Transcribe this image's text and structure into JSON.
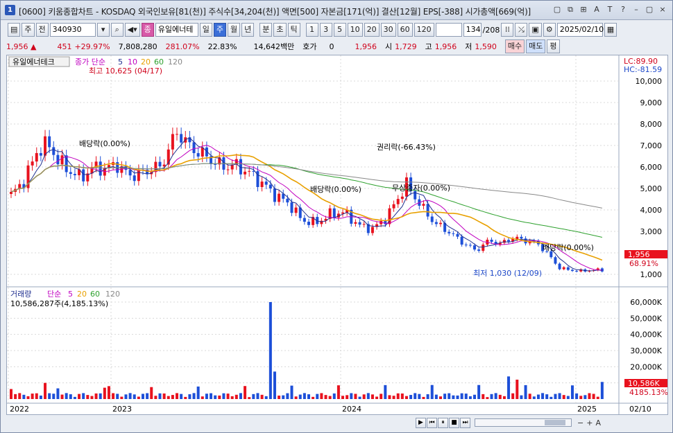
{
  "window": {
    "app_num": "1",
    "title": "[0600] 키움종합차트 - KOSDAQ 외국인보유[81(천)] 주식수[34,204(천)] 액면[500] 자본금[171(억)] 결산[12월] EPS[-388] 시가총액[669(억)]",
    "controls": [
      "▢",
      "⧉",
      "⊞",
      "A",
      "T",
      "?",
      "–",
      "▢",
      "×"
    ]
  },
  "toolbar": {
    "period_select": "주",
    "all_label": "전",
    "code": "340930",
    "stock_name": "유일에너테",
    "stock_name_prefix": "종",
    "period_buttons": [
      "일",
      "주",
      "월",
      "년"
    ],
    "active_period": "주",
    "time_buttons": [
      "분",
      "초",
      "틱"
    ],
    "interval_buttons": [
      "1",
      "3",
      "5",
      "10",
      "20",
      "30",
      "60",
      "120"
    ],
    "count": "134",
    "count_total": "/208",
    "date": "2025/02/10"
  },
  "quote": {
    "price": "1,956",
    "change": "451",
    "change_pct": "+29.97%",
    "volume": "7,808,280",
    "vol_ratio": "281.07%",
    "turnover": "22.83%",
    "amount": "14,642백만",
    "hoga_label": "호가",
    "hoga_value": "0",
    "hoga_price": "1,956",
    "open_label": "시",
    "open": "1,729",
    "high_label": "고",
    "high": "1,956",
    "low_label": "저",
    "low": "1,590",
    "buy": "매수",
    "sell": "매도",
    "avg": "평"
  },
  "price_panel": {
    "name": "유일에너테크",
    "legend_title": "종가 단순",
    "ma_periods": [
      "5",
      "10",
      "20",
      "60",
      "120"
    ],
    "high_note": "최고 10,625 (04/17)",
    "low_note": "최저 1,030 (12/09)",
    "lc": "LC:89.90",
    "hc": "HC:-81.59",
    "current_price": "1,956",
    "current_pct": "68.91%",
    "y_ticks": [
      "10,000",
      "9,000",
      "8,000",
      "7,000",
      "6,000",
      "5,000",
      "4,000",
      "3,000",
      "2,000",
      "1,000"
    ],
    "annotations": [
      {
        "text": "배당락(0.00%)"
      },
      {
        "text": "권리락(-66.43%)"
      },
      {
        "text": "배당락(0.00%)"
      },
      {
        "text": "무상증자(0.00%)"
      },
      {
        "text": "배당락(0.00%)"
      }
    ]
  },
  "volume_panel": {
    "legend_title": "거래량",
    "legend_sub": "단순",
    "ma_periods": [
      "5",
      "20",
      "60",
      "120"
    ],
    "info": "10,586,287주(4,185.13%)",
    "current_vol": "10,586K",
    "current_pct": "4185.13%",
    "y_ticks": [
      "60,000K",
      "50,000K",
      "40,000K",
      "30,000K",
      "20,000K",
      "10,000K"
    ]
  },
  "x_axis": {
    "labels": [
      "2022",
      "2023",
      "2024",
      "2025"
    ],
    "right_label": "02/10"
  },
  "colors": {
    "up": "#e8121e",
    "down": "#1d4fd8",
    "ma5": "#1f2f8f",
    "ma10": "#c000c0",
    "ma20": "#e8a000",
    "ma60": "#2ca02c",
    "ma120": "#888888"
  }
}
